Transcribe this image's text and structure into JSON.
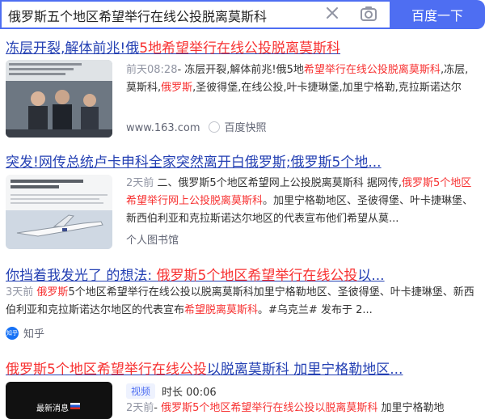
{
  "search": {
    "query": "俄罗斯五个地区希望举行在线公投脱离莫斯科",
    "button_label": "百度一下"
  },
  "results": [
    {
      "title_parts": [
        "冻层开裂,解体前兆!俄",
        "5地",
        "希望举行在线公投脱离莫斯科"
      ],
      "date": "前天08:28",
      "snippet_parts": [
        "- 冻层开裂,解体前兆!俄5地",
        "希望举行在线公投脱离莫斯科",
        ",冻层,莫斯科,",
        "俄罗斯",
        ",圣彼得堡,在线公投,叶卡捷琳堡,加里宁格勒,克拉斯诺达尔"
      ],
      "source": "www.163.com",
      "kuaizhao": "百度快照"
    },
    {
      "title": "突发!网传总统卢卡申科全家突然离开白俄罗斯;俄罗斯5个地...",
      "date": "2天前",
      "snippet_parts": [
        "二、俄罗斯5个地区希望网上公投脱离莫斯科 据网传,",
        "俄罗斯5个地区希望举行网上公投脱离莫斯科",
        "。加里宁格勒地区、圣彼得堡、叶卡捷琳堡、新西伯利亚和克拉斯诺达尔地区的代表宣布他们希望从莫..."
      ],
      "source": "个人图书馆"
    },
    {
      "title_parts": [
        "你挡着我发光了 的想法: ",
        "俄罗斯5个地区希望举行在线公投",
        "以..."
      ],
      "date": "3天前",
      "snippet_parts": [
        "俄罗斯",
        "5个地区希望举行在线公投以脱离莫斯科加里宁格勒地区、圣彼得堡、叶卡捷琳堡、新西伯利亚和克拉斯诺达尔地区的代表宣布",
        "希望脱离莫斯科",
        "。#乌克兰# 发布于 2..."
      ],
      "source": "知乎",
      "source_icon": "知乎"
    },
    {
      "title_parts": [
        "俄罗斯5个地区希望举行在线公投",
        "以脱离莫斯科",
        " 加里宁格勒地区..."
      ],
      "badge": "视频",
      "duration_label": "时长 00:06",
      "date": "2天前",
      "snippet_parts": [
        "- ",
        "俄罗斯5个地区希望举行在线公投以脱离莫斯科",
        " 加里宁格勒地"
      ],
      "thumb_text": "最新消息"
    }
  ],
  "colors": {
    "brand": "#4e6ef2",
    "link": "#2440b3",
    "highlight": "#f73131"
  }
}
